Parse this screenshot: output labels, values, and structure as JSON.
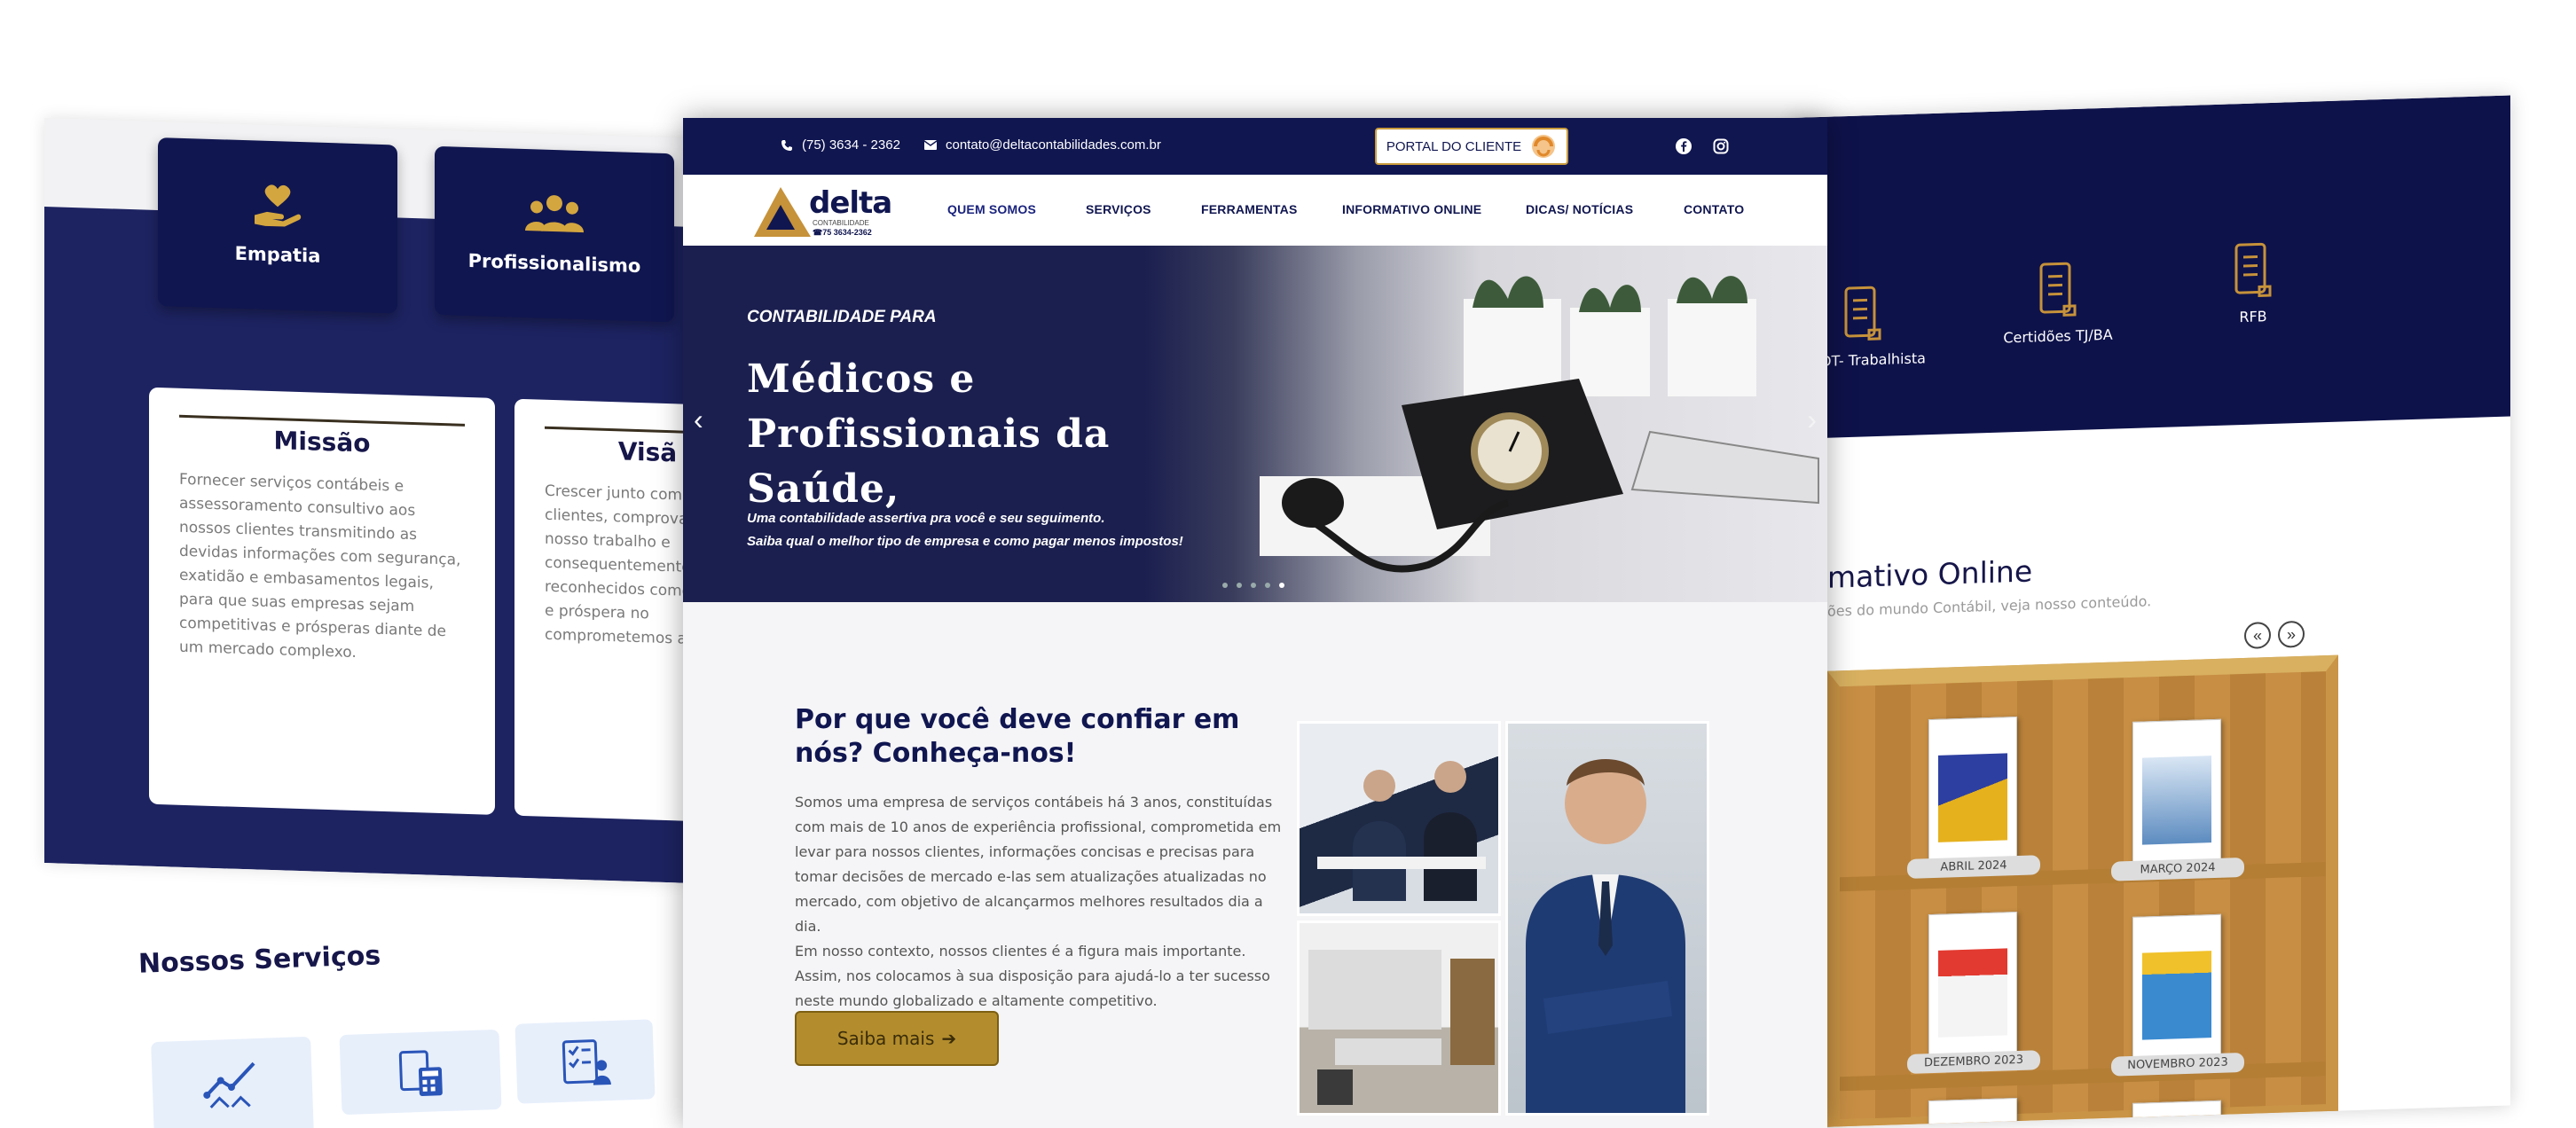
{
  "left": {
    "values": [
      {
        "label": "Empatia",
        "icon": "heart-hand-icon"
      },
      {
        "label": "Profissionalismo",
        "icon": "team-icon"
      }
    ],
    "missao": {
      "title": "Missão",
      "text": "Fornecer serviços contábeis e assessoramento consultivo aos nossos clientes transmitindo as devidas informações com segurança, exatidão e embasamentos legais, para que suas empresas sejam competitivas e prósperas diante de um mercado complexo."
    },
    "visao": {
      "title": "Visã",
      "text": "Crescer junto com os clientes, comprovand do nosso trabalho e consequentemente s reconhecidos como u séria e próspera no comprometemos a c"
    },
    "services_title": "Nossos Serviços"
  },
  "right": {
    "docs": [
      {
        "label": "CNDT- Trabalhista",
        "icon": "document-icon"
      },
      {
        "label": "Certidões TJ/BA",
        "icon": "document-icon"
      },
      {
        "label": "RFB",
        "icon": "document-icon"
      }
    ],
    "title": "mativo Online",
    "subtitle": "ões do mundo Contábil, veja nosso conteúdo.",
    "prev_arrow": "«",
    "next_arrow": "»",
    "books": [
      {
        "label": "ABRIL 2024"
      },
      {
        "label": "MARÇO 2024"
      },
      {
        "label": "DEZEMBRO 2023"
      },
      {
        "label": "NOVEMBRO 2023"
      }
    ]
  },
  "site": {
    "topbar": {
      "phone": "(75) 3634 - 2362",
      "email": "contato@deltacontabilidades.com.br",
      "portal_button": "PORTAL DO CLIENTE"
    },
    "logo": {
      "word": "delta",
      "sub": "CONTABILIDADE",
      "phone": "☎75 3634-2362"
    },
    "nav": [
      "QUEM SOMOS",
      "SERVIÇOS",
      "FERRAMENTAS",
      "INFORMATIVO ONLINE",
      "DICAS/ NOTÍCIAS",
      "CONTATO"
    ],
    "hero": {
      "kicker": "CONTABILIDADE PARA",
      "headline": "Médicos e Profissionais da Saúde,",
      "line1": "Uma contabilidade assertiva pra você e seu seguimento.",
      "line2": "Saiba qual o melhor tipo de empresa e como pagar menos impostos!",
      "prev": "‹",
      "next": "›"
    },
    "why": {
      "title": "Por que você deve confiar em nós? Conheça-nos!",
      "p1": "Somos uma empresa de serviços contábeis há 3 anos, constituídas com mais de 10 anos de experiência profissional, comprometida em levar para nossos clientes, informações concisas e precisas para tomar decisões de mercado e-las sem atualizações atualizadas no mercado, com objetivo de alcançarmos melhores resultados dia a dia.",
      "p2": "Em nosso contexto, nossos clientes é a figura mais importante. Assim, nos colocamos à sua disposição para ajudá-lo a ter sucesso neste mundo globalizado e altamente competitivo.",
      "button": "Saiba mais"
    }
  },
  "colors": {
    "navy": "#101650",
    "gold": "#b38d2d",
    "band": "#1d2361"
  }
}
